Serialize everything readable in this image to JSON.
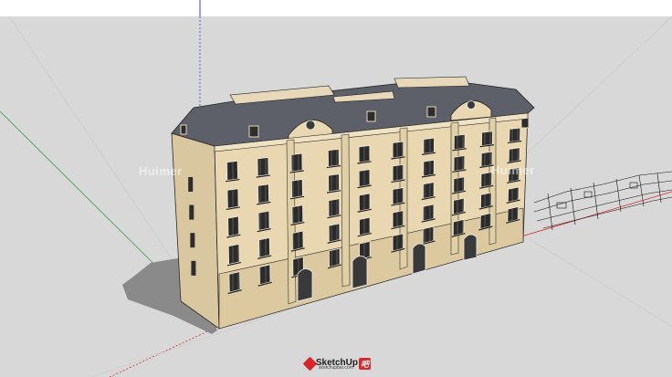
{
  "app": {
    "name": "SketchUp",
    "logo_text": "SketchUp",
    "logo_badge": "吧",
    "logo_subtext": "sketchupbar.com"
  },
  "viewport": {
    "sky_color": "#ffffff",
    "ground_color": "#d8d8d8",
    "building_wall_color": "#e8d7b0",
    "roof_color": "#5e6069",
    "watermark": [
      "Huimer",
      "Huimer"
    ]
  },
  "axes": {
    "red": "#d0282c",
    "green": "#3a9a45",
    "blue": "#3a40d6"
  },
  "icons": {
    "logo": "sketchup-logo-icon"
  }
}
